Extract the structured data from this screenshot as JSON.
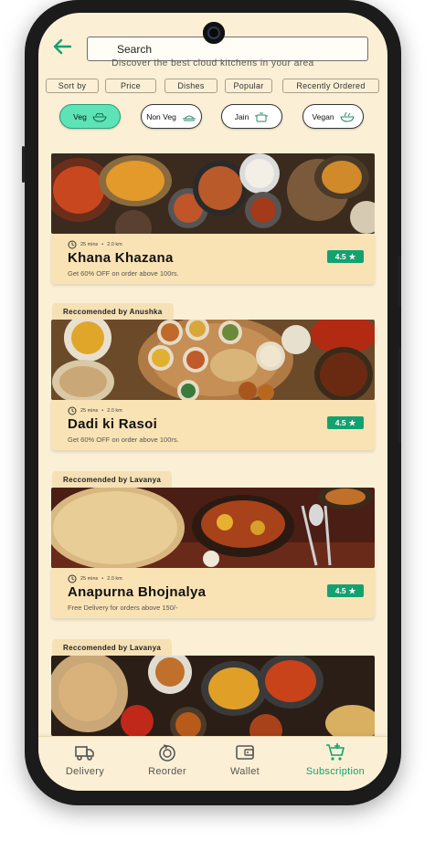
{
  "search": {
    "placeholder": "Search"
  },
  "tagline": "Discover the best cloud kitchens in your area",
  "sort_options": [
    "Sort by",
    "Price",
    "Dishes",
    "Popular",
    "Recently Ordered"
  ],
  "diet_filters": [
    {
      "label": "Veg",
      "active": true
    },
    {
      "label": "Non Veg",
      "active": false
    },
    {
      "label": "Jain",
      "active": false
    },
    {
      "label": "Vegan",
      "active": false
    }
  ],
  "kitchens": [
    {
      "recommended_by": "",
      "time": "25 mins",
      "distance": "2.0 km",
      "name": "Khana Khazana",
      "offer": "Get 60% OFF on order above 100rs.",
      "rating": "4.5"
    },
    {
      "recommended_by": "Reccomended by Anushka",
      "time": "25 mins",
      "distance": "2.0 km",
      "name": "Dadi ki Rasoi",
      "offer": "Get 60% OFF on order above 100rs.",
      "rating": "4.5"
    },
    {
      "recommended_by": "Reccomended by Lavanya",
      "time": "25 mins",
      "distance": "2.0 km",
      "name": "Anapurna Bhojnalya",
      "offer": "Free Delivery for orders above 150/-",
      "rating": "4.5"
    },
    {
      "recommended_by": "Reccomended by Lavanya",
      "time": "",
      "distance": "",
      "name": "",
      "offer": "",
      "rating": ""
    }
  ],
  "nav": [
    {
      "label": "Delivery",
      "icon": "truck-icon"
    },
    {
      "label": "Reorder",
      "icon": "reorder-icon"
    },
    {
      "label": "Wallet",
      "icon": "wallet-icon"
    },
    {
      "label": "Subscription",
      "icon": "cart-plus-icon",
      "active": true
    }
  ],
  "colors": {
    "accent": "#13a26f",
    "active_chip": "#5de3b6",
    "background": "#fbf0d6",
    "card": "#f9e3b5"
  }
}
